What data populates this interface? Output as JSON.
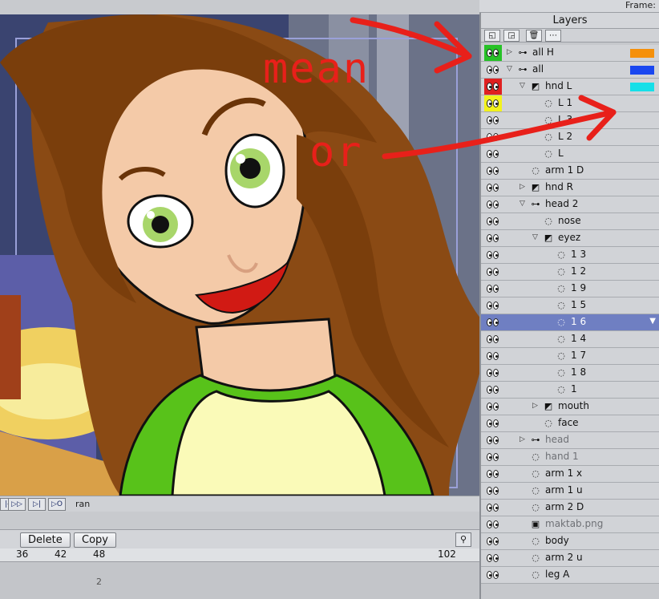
{
  "topbar": {
    "frame_label": "Frame:"
  },
  "timeline": {
    "transport_buttons": [
      "|◁",
      "▷▷",
      "▷|",
      "▷O"
    ],
    "frame_word": "ran",
    "delete_label": "Delete",
    "copy_label": "Copy",
    "ruler_ticks": [
      "36",
      "42",
      "48",
      "102"
    ],
    "track_marker": "2"
  },
  "panel": {
    "title": "Layers",
    "tools": [
      "new-layer-icon",
      "duplicate-layer-icon",
      "trash-icon",
      "more-icon"
    ]
  },
  "annotations": {
    "word1": "mean",
    "word2": "or"
  },
  "layers": [
    {
      "name": "all H",
      "indent": 0,
      "twisty": "▷",
      "type": "bone",
      "swatch": "#f5900a",
      "tag": "#27c227"
    },
    {
      "name": "all",
      "indent": 0,
      "twisty": "▽",
      "type": "bone",
      "swatch": "#1a47f0"
    },
    {
      "name": "hnd L",
      "indent": 1,
      "twisty": "▽",
      "type": "switch",
      "swatch": "#16dfe8",
      "tag": "#e02020"
    },
    {
      "name": "L 1",
      "indent": 2,
      "twisty": "",
      "type": "vector",
      "tag": "#f2f21c"
    },
    {
      "name": "L 3",
      "indent": 2,
      "twisty": "",
      "type": "vector"
    },
    {
      "name": "L 2",
      "indent": 2,
      "twisty": "",
      "type": "vector"
    },
    {
      "name": "L",
      "indent": 2,
      "twisty": "",
      "type": "vector"
    },
    {
      "name": "arm 1 D",
      "indent": 1,
      "twisty": "",
      "type": "vector"
    },
    {
      "name": "hnd R",
      "indent": 1,
      "twisty": "▷",
      "type": "switch"
    },
    {
      "name": "head 2",
      "indent": 1,
      "twisty": "▽",
      "type": "bone"
    },
    {
      "name": "nose",
      "indent": 2,
      "twisty": "",
      "type": "vector"
    },
    {
      "name": "eyez",
      "indent": 2,
      "twisty": "▽",
      "type": "switch"
    },
    {
      "name": "1 3",
      "indent": 3,
      "twisty": "",
      "type": "vector"
    },
    {
      "name": "1 2",
      "indent": 3,
      "twisty": "",
      "type": "vector"
    },
    {
      "name": "1 9",
      "indent": 3,
      "twisty": "",
      "type": "vector"
    },
    {
      "name": "1 5",
      "indent": 3,
      "twisty": "",
      "type": "vector"
    },
    {
      "name": "1 6",
      "indent": 3,
      "twisty": "",
      "type": "vector",
      "selected": true
    },
    {
      "name": "1 4",
      "indent": 3,
      "twisty": "",
      "type": "vector"
    },
    {
      "name": "1 7",
      "indent": 3,
      "twisty": "",
      "type": "vector"
    },
    {
      "name": "1 8",
      "indent": 3,
      "twisty": "",
      "type": "vector"
    },
    {
      "name": "1",
      "indent": 3,
      "twisty": "",
      "type": "vector"
    },
    {
      "name": "mouth",
      "indent": 2,
      "twisty": "▷",
      "type": "switch"
    },
    {
      "name": "face",
      "indent": 2,
      "twisty": "",
      "type": "vector"
    },
    {
      "name": "head",
      "indent": 1,
      "twisty": "▷",
      "type": "bone",
      "dim": true
    },
    {
      "name": "hand 1",
      "indent": 1,
      "twisty": "",
      "type": "vector",
      "dim": true
    },
    {
      "name": "arm 1 x",
      "indent": 1,
      "twisty": "",
      "type": "vector"
    },
    {
      "name": "arm 1 u",
      "indent": 1,
      "twisty": "",
      "type": "vector"
    },
    {
      "name": "arm 2 D",
      "indent": 1,
      "twisty": "",
      "type": "vector"
    },
    {
      "name": "maktab.png",
      "indent": 1,
      "twisty": "",
      "type": "image",
      "dim": true
    },
    {
      "name": "body",
      "indent": 1,
      "twisty": "",
      "type": "vector"
    },
    {
      "name": "arm 2 u",
      "indent": 1,
      "twisty": "",
      "type": "vector"
    },
    {
      "name": "leg A",
      "indent": 1,
      "twisty": "",
      "type": "vector"
    }
  ],
  "colors": {
    "selection": "#6f7fc2",
    "annotation_red": "#e8201a"
  }
}
